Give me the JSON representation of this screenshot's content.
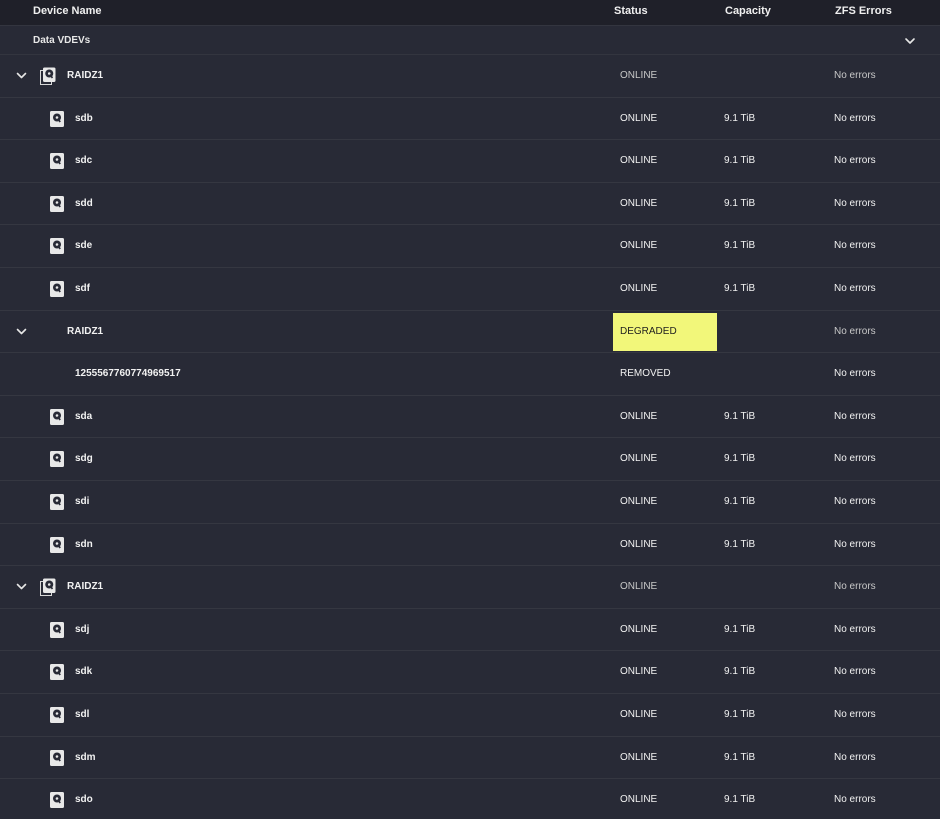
{
  "header": {
    "device_name": "Device Name",
    "status": "Status",
    "capacity": "Capacity",
    "zfs_errors": "ZFS Errors"
  },
  "group": {
    "label": "Data VDEVs"
  },
  "rows": [
    {
      "kind": "vdev",
      "name": "RAIDZ1",
      "status": "ONLINE",
      "capacity": "",
      "errors": "No errors"
    },
    {
      "kind": "disk",
      "name": "sdb",
      "status": "ONLINE",
      "capacity": "9.1 TiB",
      "errors": "No errors"
    },
    {
      "kind": "disk",
      "name": "sdc",
      "status": "ONLINE",
      "capacity": "9.1 TiB",
      "errors": "No errors"
    },
    {
      "kind": "disk",
      "name": "sdd",
      "status": "ONLINE",
      "capacity": "9.1 TiB",
      "errors": "No errors"
    },
    {
      "kind": "disk",
      "name": "sde",
      "status": "ONLINE",
      "capacity": "9.1 TiB",
      "errors": "No errors"
    },
    {
      "kind": "disk",
      "name": "sdf",
      "status": "ONLINE",
      "capacity": "9.1 TiB",
      "errors": "No errors"
    },
    {
      "kind": "vdev-noicon",
      "name": "RAIDZ1",
      "status": "DEGRADED",
      "capacity": "",
      "errors": "No errors"
    },
    {
      "kind": "removed",
      "name": "1255567760774969517",
      "status": "REMOVED",
      "capacity": "",
      "errors": "No errors"
    },
    {
      "kind": "disk",
      "name": "sda",
      "status": "ONLINE",
      "capacity": "9.1 TiB",
      "errors": "No errors"
    },
    {
      "kind": "disk",
      "name": "sdg",
      "status": "ONLINE",
      "capacity": "9.1 TiB",
      "errors": "No errors"
    },
    {
      "kind": "disk",
      "name": "sdi",
      "status": "ONLINE",
      "capacity": "9.1 TiB",
      "errors": "No errors"
    },
    {
      "kind": "disk",
      "name": "sdn",
      "status": "ONLINE",
      "capacity": "9.1 TiB",
      "errors": "No errors"
    },
    {
      "kind": "vdev",
      "name": "RAIDZ1",
      "status": "ONLINE",
      "capacity": "",
      "errors": "No errors"
    },
    {
      "kind": "disk",
      "name": "sdj",
      "status": "ONLINE",
      "capacity": "9.1 TiB",
      "errors": "No errors"
    },
    {
      "kind": "disk",
      "name": "sdk",
      "status": "ONLINE",
      "capacity": "9.1 TiB",
      "errors": "No errors"
    },
    {
      "kind": "disk",
      "name": "sdl",
      "status": "ONLINE",
      "capacity": "9.1 TiB",
      "errors": "No errors"
    },
    {
      "kind": "disk",
      "name": "sdm",
      "status": "ONLINE",
      "capacity": "9.1 TiB",
      "errors": "No errors"
    },
    {
      "kind": "disk",
      "name": "sdo",
      "status": "ONLINE",
      "capacity": "9.1 TiB",
      "errors": "No errors"
    }
  ],
  "colors": {
    "background": "#282a36",
    "header_background": "#1f2029",
    "degraded_highlight": "#f2f77a"
  },
  "icons": {
    "expand": "chevron-down-icon",
    "disk": "hard-drive-icon",
    "vdev": "vdev-stack-icon"
  }
}
